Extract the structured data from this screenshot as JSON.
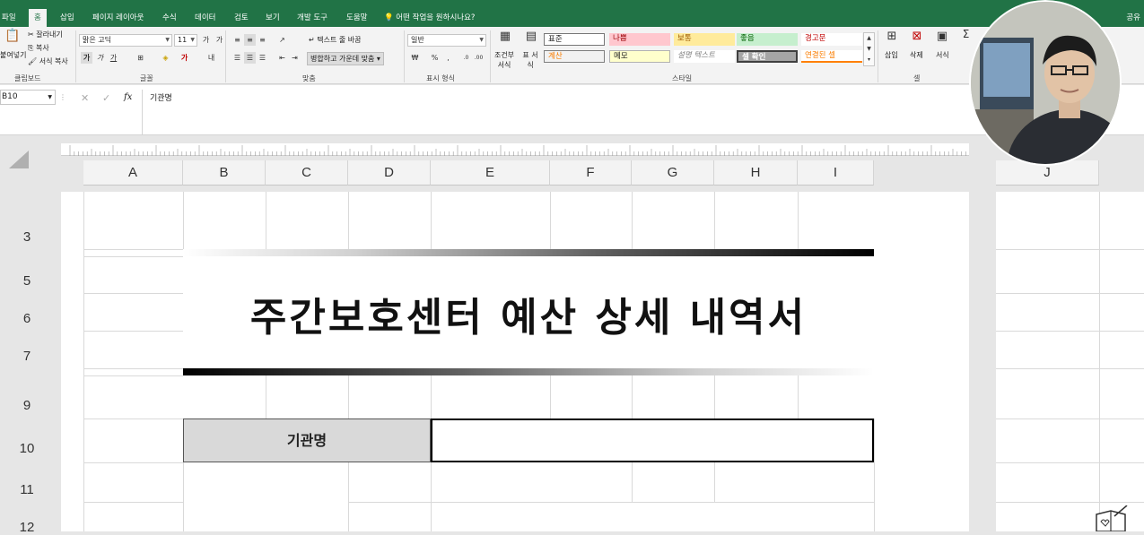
{
  "tabs": [
    "파일",
    "홈",
    "삽입",
    "페이지 레이아웃",
    "수식",
    "데이터",
    "검토",
    "보기",
    "개발 도구",
    "도움말"
  ],
  "active_tab": "홈",
  "tell_me": "어떤 작업을 원하시나요?",
  "share": "공유",
  "clipboard": {
    "paste": "붙여넣기",
    "cut": "잘라내기",
    "copy": "복사",
    "format_painter": "서식 복사",
    "label": "클립보드"
  },
  "font": {
    "name": "맑은 고딕",
    "size": "11",
    "bold": "가",
    "italic": "가",
    "underline": "가",
    "label": "글꼴"
  },
  "alignment": {
    "wrap": "텍스트 줄 바꿈",
    "merge": "병합하고 가운데 맞춤",
    "label": "맞춤"
  },
  "number": {
    "format": "일반",
    "percent": "%",
    "label": "표시 형식"
  },
  "styles": {
    "conditional": "조건부 서식",
    "table": "표 서식",
    "items": [
      "표준",
      "나쁨",
      "보통",
      "좋음",
      "경고문",
      "계산",
      "메모",
      "설명 텍스트",
      "셀 확인",
      "연결된 셀"
    ],
    "label": "스타일"
  },
  "cells": {
    "insert": "삽입",
    "delete": "삭제",
    "format": "서식",
    "label": "셀"
  },
  "formula_bar": {
    "name_box": "B10",
    "fx": "fx",
    "content": "기관명"
  },
  "columns": [
    "A",
    "B",
    "C",
    "D",
    "E",
    "F",
    "G",
    "H",
    "I",
    "J"
  ],
  "rows": [
    "3",
    "5",
    "6",
    "7",
    "9",
    "10",
    "11",
    "12"
  ],
  "sheet": {
    "title": "주간보호센터 예산 상세 내역서",
    "label_cell": "기관명",
    "value_cell": ""
  },
  "colors": {
    "excel_green": "#217346",
    "title_text": "#111111",
    "label_fill": "#d9d9d9"
  }
}
